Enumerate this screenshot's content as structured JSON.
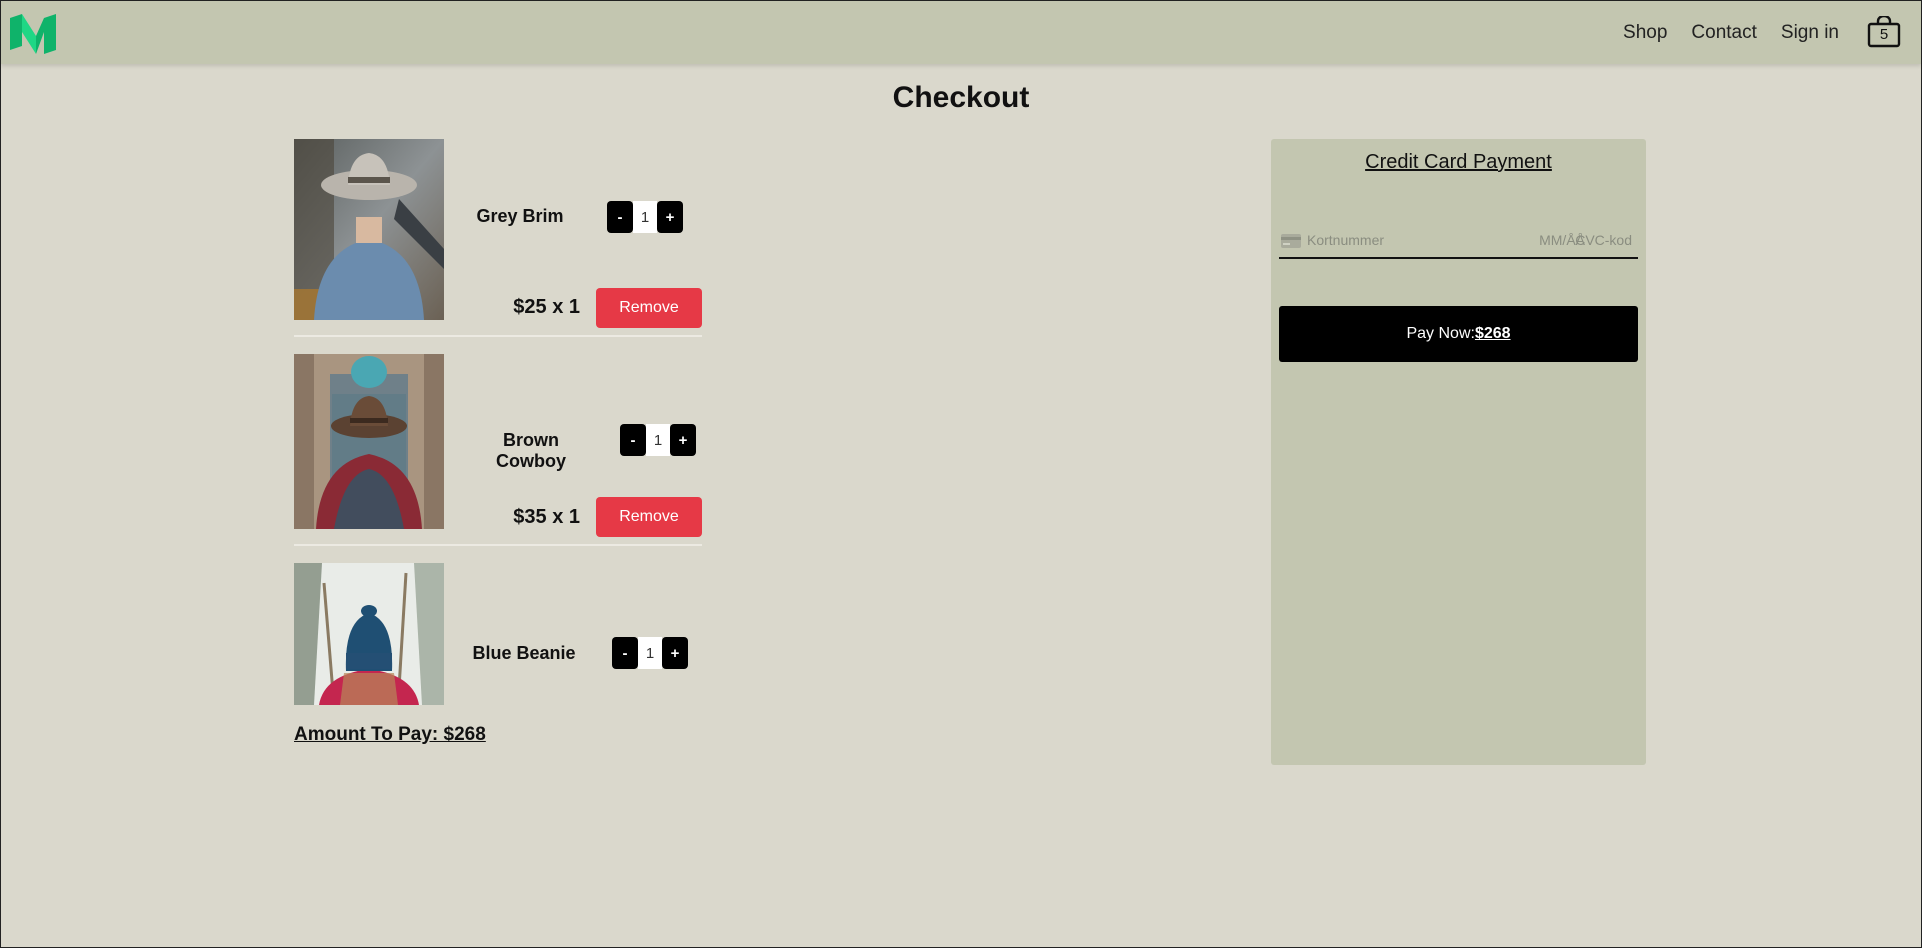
{
  "header": {
    "logo": "medium-logo",
    "nav": [
      "Shop",
      "Contact",
      "Sign in"
    ],
    "cart_count": "5",
    "brand_colors": [
      "#0fb36a",
      "#1fd785"
    ]
  },
  "page": {
    "title": "Checkout"
  },
  "items": [
    {
      "name": "Grey Brim",
      "quantity": "1",
      "price": "$25 x 1",
      "remove_label": "Remove",
      "image": "man-grey-brim-hat-photo"
    },
    {
      "name": "Brown Cowboy",
      "quantity": "1",
      "price": "$35 x 1",
      "remove_label": "Remove",
      "image": "woman-brown-cowboy-hat-photo"
    },
    {
      "name": "Blue Beanie",
      "quantity": "1",
      "image": "woman-blue-beanie-photo"
    }
  ],
  "qty_controls": {
    "minus": "-",
    "plus": "+"
  },
  "total_label": "Amount To Pay: $268",
  "payment": {
    "title": "Credit Card Payment",
    "card_placeholder": "Kortnummer",
    "expiry_placeholder": "MM/ÅÅ",
    "cvc_placeholder": "CVC-kod",
    "pay_label": "Pay Now:",
    "pay_amount": "$268"
  },
  "colors": {
    "background": "#dad8cc",
    "panel": "#c3c6b0",
    "remove": "#e63946",
    "button": "#000000"
  }
}
